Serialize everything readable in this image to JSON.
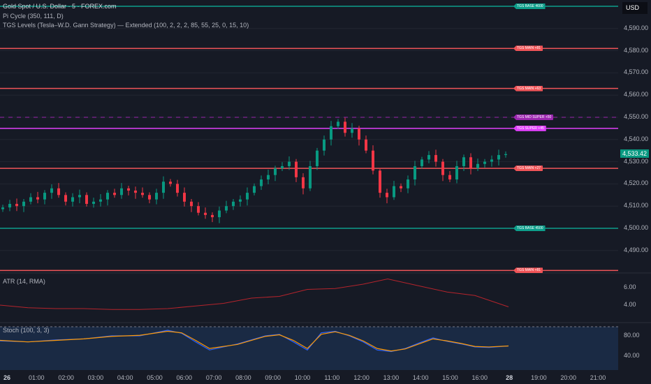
{
  "legend": {
    "symbol": "Gold Spot / U.S. Dollar · 5 · FOREX.com",
    "pi": "Pi Cycle (350, 111, D)",
    "tgs": "TGS Levels (Tesla–W.D. Gann Strategy) — Extended (100, 2, 2, 2, 85, 55, 25, 0, 15, 10)",
    "atr": "ATR (14, RMA)",
    "stoch": "Stoch (100, 3, 3)"
  },
  "currency": "USD",
  "last_price": "4,533.42",
  "colors": {
    "up": "#089981",
    "down": "#f23645",
    "main": "#f05458",
    "base": "#0d9e8b",
    "super": "#e040fb",
    "mid": "#9c27b0",
    "atr": "#b5242c",
    "k": "#2962ff",
    "d": "#ff9800"
  },
  "chart_data": [
    {
      "type": "candlestick",
      "title": "Gold Spot / U.S. Dollar · 5",
      "yticks": [
        "4,590.00",
        "4,580.00",
        "4,570.00",
        "4,560.00",
        "4,550.00",
        "4,540.00",
        "4,530.00",
        "4,520.00",
        "4,510.00",
        "4,500.00",
        "4,490.00"
      ],
      "ytick_values": [
        4590,
        4580,
        4570,
        4560,
        4550,
        4540,
        4530,
        4520,
        4510,
        4500,
        4490
      ],
      "closes": [
        4509.4,
        4511,
        4510,
        4512,
        4514,
        4513,
        4516,
        4518,
        4515,
        4512,
        4514,
        4515,
        4511,
        4512,
        4513,
        4516,
        4515,
        4518,
        4517,
        4516,
        4515,
        4513,
        4516,
        4521,
        4520,
        4516,
        4512,
        4510,
        4507,
        4506,
        4505,
        4508,
        4510,
        4512,
        4513,
        4516,
        4519,
        4522,
        4524,
        4527,
        4528,
        4530,
        4523,
        4518,
        4528,
        4535,
        4540,
        4546,
        4548,
        4543,
        4545,
        4540,
        4535,
        4526,
        4516,
        4514,
        4519,
        4518,
        4522,
        4528,
        4531,
        4533,
        4530,
        4524,
        4522,
        4528,
        4532,
        4527,
        4529,
        4530,
        4531,
        4533,
        4533.42
      ],
      "levels": [
        {
          "label": "TGS BASE 4600",
          "price": 4600,
          "kind": "base"
        },
        {
          "label": "TGS MAIN +81",
          "price": 4581,
          "kind": "main"
        },
        {
          "label": "TGS MAIN +63",
          "price": 4563,
          "kind": "main"
        },
        {
          "label": "TGS MID SUPER +50",
          "price": 4550,
          "kind": "mid"
        },
        {
          "label": "TGS SUPER +45",
          "price": 4545,
          "kind": "super"
        },
        {
          "label": "TGS MAIN +27",
          "price": 4527,
          "kind": "main"
        },
        {
          "label": "TGS BASE 4500",
          "price": 4500,
          "kind": "base"
        },
        {
          "label": "TGS MAIN +81",
          "price": 4481,
          "kind": "main"
        }
      ]
    },
    {
      "type": "line",
      "title": "ATR (14, RMA)",
      "yticks": [
        "6.00",
        "4.00"
      ],
      "ytick_values": [
        6,
        4
      ],
      "x_index": [
        0,
        40,
        80,
        120,
        160,
        200,
        240,
        280,
        320,
        360,
        400,
        440,
        480,
        520,
        555,
        600,
        640,
        680,
        728
      ],
      "values": [
        4.0,
        3.7,
        3.6,
        3.6,
        3.5,
        3.5,
        3.6,
        3.9,
        4.2,
        4.8,
        5.0,
        5.8,
        5.9,
        6.4,
        7.0,
        6.2,
        5.5,
        5.1,
        3.8
      ]
    },
    {
      "type": "line",
      "title": "Stoch (100, 3, 3)",
      "yticks": [
        "80.00",
        "40.00"
      ],
      "ytick_values": [
        80,
        40
      ],
      "x_index": [
        0,
        40,
        80,
        120,
        160,
        200,
        240,
        260,
        280,
        300,
        340,
        380,
        400,
        420,
        440,
        460,
        480,
        500,
        520,
        540,
        560,
        580,
        600,
        620,
        640,
        660,
        680,
        700,
        728
      ],
      "k": [
        70,
        68,
        72,
        74,
        80,
        80,
        91,
        85,
        68,
        52,
        64,
        80,
        83,
        68,
        52,
        86,
        89,
        80,
        68,
        52,
        49,
        55,
        66,
        76,
        69,
        64,
        58,
        57,
        60
      ],
      "d": [
        71,
        68,
        71,
        74,
        79,
        81,
        89,
        86,
        71,
        55,
        63,
        79,
        82,
        71,
        55,
        83,
        88,
        81,
        70,
        55,
        50,
        54,
        64,
        74,
        70,
        65,
        59,
        58,
        60
      ]
    }
  ],
  "xaxis": [
    "26",
    "01:00",
    "02:00",
    "03:00",
    "04:00",
    "05:00",
    "06:00",
    "07:00",
    "08:00",
    "09:00",
    "10:00",
    "11:00",
    "12:00",
    "13:00",
    "14:00",
    "15:00",
    "16:00",
    "28",
    "19:00",
    "20:00",
    "21:00"
  ]
}
